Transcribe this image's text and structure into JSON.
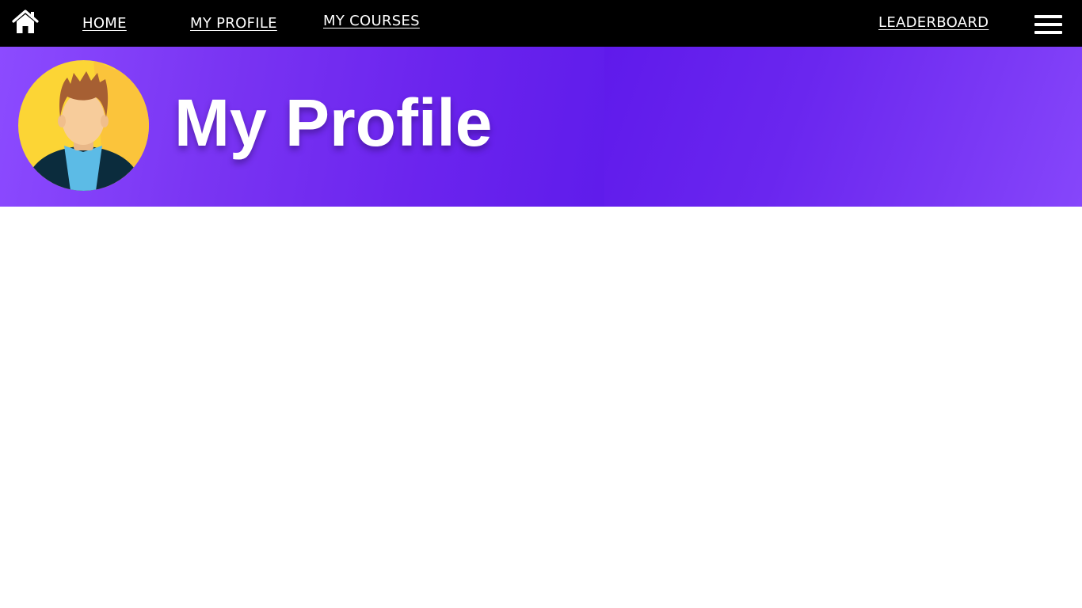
{
  "nav": {
    "home_icon": "home-icon",
    "links": {
      "home": "HOME",
      "my_profile": "MY PROFILE",
      "my_courses": "MY COURSES",
      "leaderboard": "LEADERBOARD"
    },
    "menu_icon": "hamburger-menu-icon"
  },
  "banner": {
    "title": "My Profile",
    "avatar_icon": "user-avatar"
  },
  "colors": {
    "navbar": "#000000",
    "banner_accent": "#6b24ee",
    "avatar_background": "#fcd535",
    "text": "#ffffff"
  }
}
